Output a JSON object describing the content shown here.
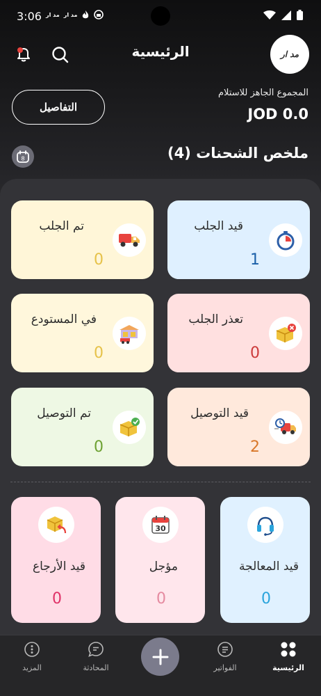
{
  "status_bar": {
    "time": "3:06",
    "notif_1": "مد ار",
    "notif_2": "مد ار"
  },
  "header": {
    "title": "الرئيسية",
    "logo_text": "مد ار"
  },
  "balance": {
    "label": "المجموع الجاهز للاستلام",
    "amount": "JOD 0.0",
    "details_button": "التفاصيل"
  },
  "summary": {
    "title": "ملخص الشحنات (4)",
    "calendar_badge": "8"
  },
  "cards": [
    {
      "id": "pending-pickup",
      "label": "قيد الجلب",
      "count": "1",
      "bg": "#dff0ff",
      "count_color": "#1a5fa8"
    },
    {
      "id": "picked-up",
      "label": "تم الجلب",
      "count": "0",
      "bg": "#fff6d8",
      "count_color": "#e6c24a"
    },
    {
      "id": "pickup-failed",
      "label": "تعذر الجلب",
      "count": "0",
      "bg": "#ffe0e0",
      "count_color": "#cc3b3b"
    },
    {
      "id": "in-warehouse",
      "label": "في المستودع",
      "count": "0",
      "bg": "#fff7dc",
      "count_color": "#e6c24a"
    },
    {
      "id": "out-for-delivery",
      "label": "قيد التوصيل",
      "count": "2",
      "bg": "#ffe9dc",
      "count_color": "#d9782a"
    },
    {
      "id": "delivered",
      "label": "تم التوصيل",
      "count": "0",
      "bg": "#eef8e4",
      "count_color": "#6ea234"
    },
    {
      "id": "processing",
      "label": "قيد المعالجة",
      "count": "0",
      "bg": "#e0f1ff",
      "count_color": "#2aa4dc"
    },
    {
      "id": "postponed",
      "label": "مؤجل",
      "count": "0",
      "bg": "#ffe6ec",
      "count_color": "#e58aa0"
    },
    {
      "id": "returning",
      "label": "قيد الأرجاع",
      "count": "0",
      "bg": "#ffdce6",
      "count_color": "#e03268"
    }
  ],
  "calendar_icon_text": "30",
  "nav": [
    {
      "id": "home",
      "label": "الرئيسية",
      "active": true
    },
    {
      "id": "invoices",
      "label": "الفواتير"
    },
    {
      "id": "chat",
      "label": "المحادثة"
    },
    {
      "id": "more",
      "label": "المزيد"
    }
  ],
  "colors": {
    "accent": "#7b7b8c",
    "panel": "#333337",
    "background": "#1e1e21"
  }
}
